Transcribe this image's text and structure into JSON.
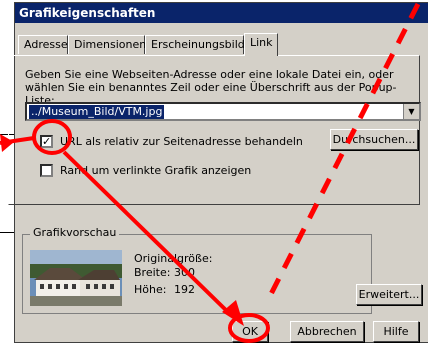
{
  "dialog": {
    "title": "Grafikeigenschaften",
    "tabs": [
      {
        "label": "Adresse",
        "active": false
      },
      {
        "label": "Dimensionen",
        "active": false
      },
      {
        "label": "Erscheinungsbild",
        "active": false
      },
      {
        "label": "Link",
        "active": true
      }
    ]
  },
  "link": {
    "description": "Geben Sie eine Webseiten-Adresse oder eine lokale Datei ein, oder wählen Sie ein benanntes Zeil oder eine Überschrift aus der Popup-Liste:",
    "url_value": "../Museum_Bild/VTM.jpg",
    "relative_label": "URL als relativ zur Seitenadresse behandeln",
    "relative_checked": true,
    "border_label": "Rand um verlinkte Grafik anzeigen",
    "border_checked": false,
    "browse_label": "Durchsuchen..."
  },
  "preview": {
    "group_label": "Grafikvorschau",
    "original_size_label": "Originalgröße:",
    "width_label": "Breite:",
    "width_value": "300",
    "height_label": "Höhe:",
    "height_value": "192"
  },
  "buttons": {
    "advanced_label": "Erweitert...",
    "ok_label": "OK",
    "cancel_label": "Abbrechen",
    "help_label": "Hilfe"
  },
  "colors": {
    "annotation": "#ff0000",
    "titlebar": "#0a246a",
    "face": "#d4d0c8"
  }
}
